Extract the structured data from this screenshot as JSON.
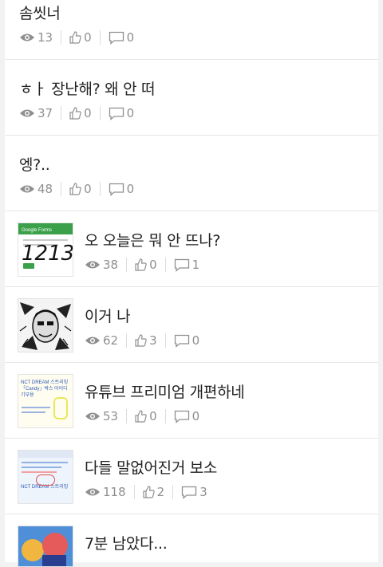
{
  "posts": [
    {
      "title": "솜씻너",
      "views": "13",
      "likes": "0",
      "comments": "0"
    },
    {
      "title": "ㅎㅏ 장난해? 왜 안 떠",
      "views": "37",
      "likes": "0",
      "comments": "0"
    },
    {
      "title": "엥?..",
      "views": "48",
      "likes": "0",
      "comments": "0"
    },
    {
      "title": "오 오늘은 뭐 안 뜨나?",
      "views": "38",
      "likes": "0",
      "comments": "1",
      "thumb_header": "Google Forms",
      "thumb_scrawl": "1213"
    },
    {
      "title": "이거 나",
      "views": "62",
      "likes": "3",
      "comments": "0"
    },
    {
      "title": "유튜브 프리미엄 개편하네",
      "views": "53",
      "likes": "0",
      "comments": "0",
      "thumb_text": "NCT DREAM 스트리밍「Candy」박스 아이디 기부용"
    },
    {
      "title": "다들 말없어진거 보소",
      "views": "118",
      "likes": "2",
      "comments": "3",
      "thumb_text": "NCT DREAM 스트리밍"
    },
    {
      "title": "7분 남았다...",
      "views": "",
      "likes": "",
      "comments": ""
    }
  ],
  "colors": {
    "meta": "#8f8f8f",
    "text": "#222222",
    "divider": "#e6e6e6",
    "google_green": "#3aa14a"
  }
}
